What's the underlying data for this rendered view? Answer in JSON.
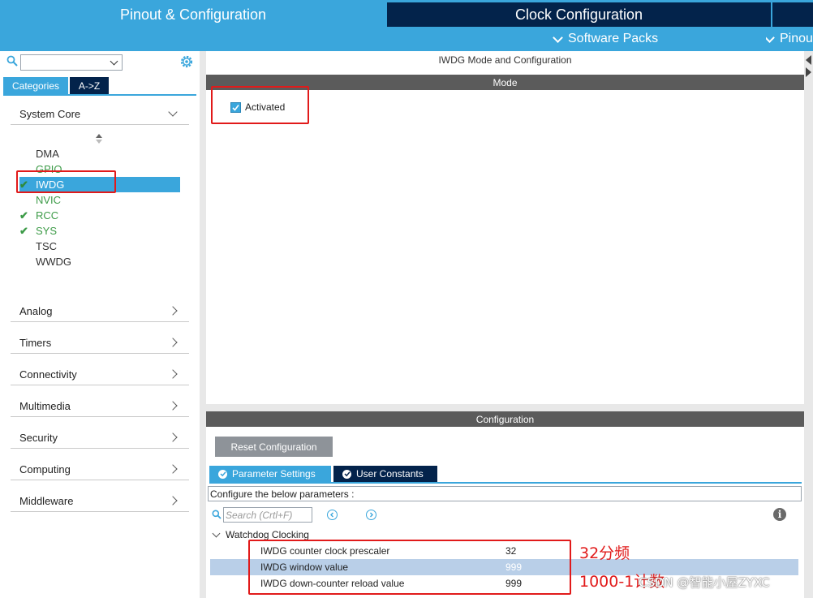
{
  "top_tabs": {
    "pinout": "Pinout & Configuration",
    "clock": "Clock Configuration"
  },
  "sub_menu": {
    "software_packs": "Software Packs",
    "pinout_menu": "Pinou"
  },
  "left_panel": {
    "search_value": "",
    "tabs": {
      "categories": "Categories",
      "az": "A->Z"
    },
    "system_core": {
      "label": "System Core",
      "items": [
        {
          "name": "DMA",
          "checked": false,
          "color": "#333333"
        },
        {
          "name": "GPIO",
          "checked": false,
          "color": "#3d9b48"
        },
        {
          "name": "IWDG",
          "checked": true,
          "color": "#ffffff"
        },
        {
          "name": "NVIC",
          "checked": false,
          "color": "#3d9b48"
        },
        {
          "name": "RCC",
          "checked": true,
          "color": "#3d9b48"
        },
        {
          "name": "SYS",
          "checked": true,
          "color": "#3d9b48"
        },
        {
          "name": "TSC",
          "checked": false,
          "color": "#333333"
        },
        {
          "name": "WWDG",
          "checked": false,
          "color": "#333333"
        }
      ]
    },
    "sections": [
      "Analog",
      "Timers",
      "Connectivity",
      "Multimedia",
      "Security",
      "Computing",
      "Middleware"
    ]
  },
  "mode_panel": {
    "title": "IWDG Mode and Configuration",
    "mode_header": "Mode",
    "activated_label": "Activated",
    "activated": true
  },
  "config_panel": {
    "header": "Configuration",
    "reset_button": "Reset Configuration",
    "tabs": {
      "parameter_settings": "Parameter Settings",
      "user_constants": "User Constants"
    },
    "instruction": "Configure the below parameters :",
    "search_placeholder": "Search (Crtl+F)",
    "group": "Watchdog Clocking",
    "params": [
      {
        "name": "IWDG counter clock prescaler",
        "value": "32"
      },
      {
        "name": "IWDG window value",
        "value": "999"
      },
      {
        "name": "IWDG down-counter reload value",
        "value": "999"
      }
    ]
  },
  "annotations": {
    "prescaler_note": "32分频",
    "reload_note": "1000-1计数"
  },
  "watermark": "CSDN @智能小屋ZYXC",
  "colors": {
    "accent": "#3aa6dc",
    "navy": "#03234b",
    "highlight": "#e11a1a",
    "ok_green": "#3d9b48"
  }
}
